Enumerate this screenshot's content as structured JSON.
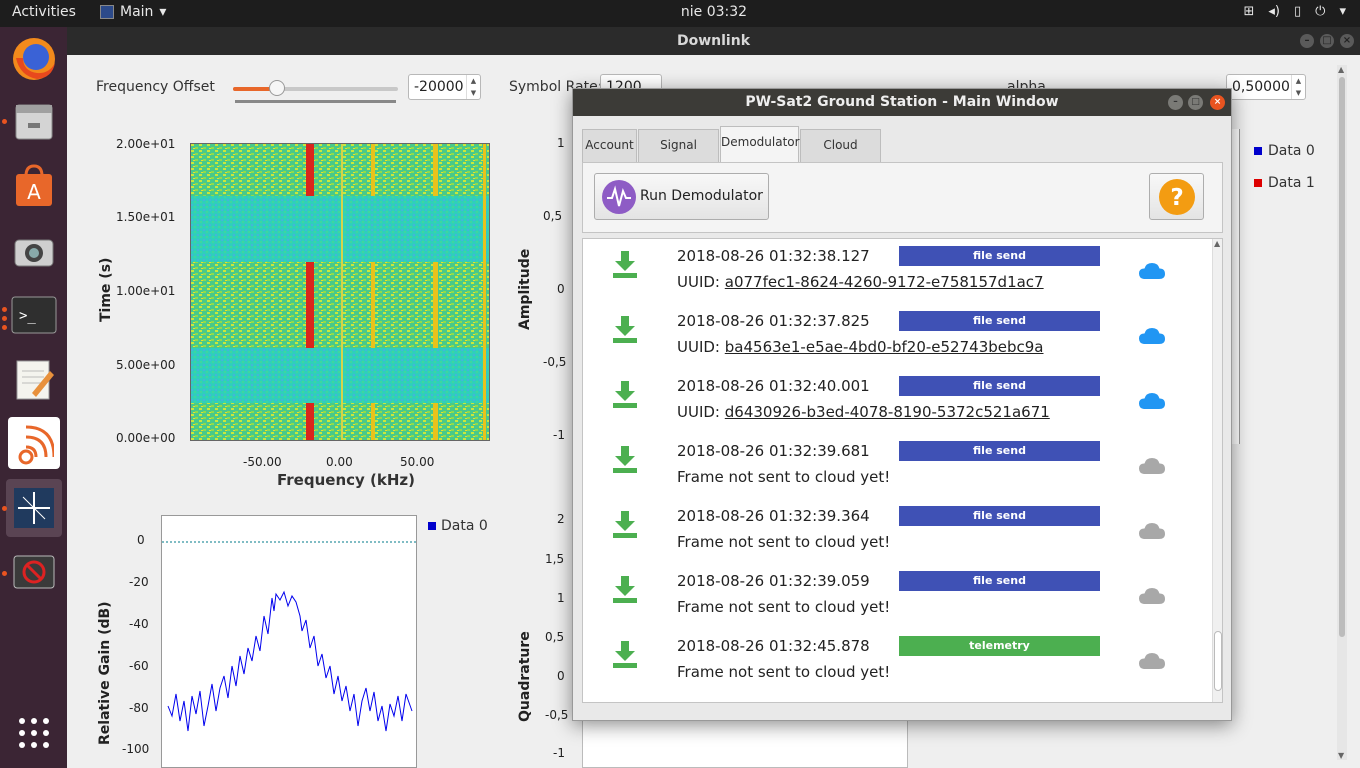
{
  "topbar": {
    "activities": "Activities",
    "app_menu": "Main",
    "clock": "nie 03:32"
  },
  "main_window": {
    "title": "Downlink",
    "frequency_offset": {
      "label": "Frequency Offset",
      "value": "-20000",
      "slider_fraction": 0.26
    },
    "symbol_rate": {
      "label": "Symbol Rate:",
      "value": "1200"
    },
    "alpha": {
      "label": "alpha",
      "value": "0,50000"
    },
    "waterfall": {
      "y_ticks": [
        "2.00e+01",
        "1.50e+01",
        "1.00e+01",
        "5.00e+00",
        "0.00e+00"
      ],
      "x_ticks": [
        "-50.00",
        "0.00",
        "50.00"
      ],
      "xlabel": "Frequency (kHz)",
      "ylabel": "Time (s)"
    },
    "spectrum": {
      "y_ticks": [
        "0",
        "-20",
        "-40",
        "-60",
        "-80",
        "-100"
      ],
      "ylabel": "Relative Gain (dB)",
      "legend": "Data 0"
    },
    "time_plot": {
      "y_ticks": [
        "1",
        "0,5",
        "0",
        "-0,5",
        "-1"
      ],
      "ylabel": "Amplitude",
      "legend": [
        "Data 0",
        "Data 1"
      ],
      "legend_colors": [
        "#0000cc",
        "#dd0000"
      ]
    },
    "constellation": {
      "y_ticks": [
        "2",
        "1,5",
        "1",
        "0,5",
        "0",
        "-0,5",
        "-1"
      ],
      "ylabel": "Quadrature"
    }
  },
  "pw_window": {
    "title": "PW-Sat2 Ground Station - Main Window",
    "tabs": [
      "Account",
      "Signal Source",
      "Demodulator",
      "Cloud Upload"
    ],
    "run_button": "Run Demodulator",
    "help_icon": "question-icon",
    "frames": [
      {
        "time": "2018-08-26 01:32:38.127",
        "uuid_label": "UUID: ",
        "uuid": "a077fec1-8624-4260-9172-e758157d1ac7",
        "badge": "file send",
        "badge_color": "#3f51b5",
        "cloud": "#2196f3"
      },
      {
        "time": "2018-08-26 01:32:37.825",
        "uuid_label": "UUID: ",
        "uuid": "ba4563e1-e5ae-4bd0-bf20-e52743bebc9a",
        "badge": "file send",
        "badge_color": "#3f51b5",
        "cloud": "#2196f3"
      },
      {
        "time": "2018-08-26 01:32:40.001",
        "uuid_label": "UUID: ",
        "uuid": "d6430926-b3ed-4078-8190-5372c521a671",
        "badge": "file send",
        "badge_color": "#3f51b5",
        "cloud": "#2196f3"
      },
      {
        "time": "2018-08-26 01:32:39.681",
        "status": "Frame not sent to cloud yet!",
        "badge": "file send",
        "badge_color": "#3f51b5",
        "cloud": "#a8a8a8"
      },
      {
        "time": "2018-08-26 01:32:39.364",
        "status": "Frame not sent to cloud yet!",
        "badge": "file send",
        "badge_color": "#3f51b5",
        "cloud": "#a8a8a8"
      },
      {
        "time": "2018-08-26 01:32:39.059",
        "status": "Frame not sent to cloud yet!",
        "badge": "file send",
        "badge_color": "#3f51b5",
        "cloud": "#a8a8a8"
      },
      {
        "time": "2018-08-26 01:32:45.878",
        "status": "Frame not sent to cloud yet!",
        "badge": "telemetry",
        "badge_color": "#4caf50",
        "cloud": "#a8a8a8"
      }
    ]
  }
}
